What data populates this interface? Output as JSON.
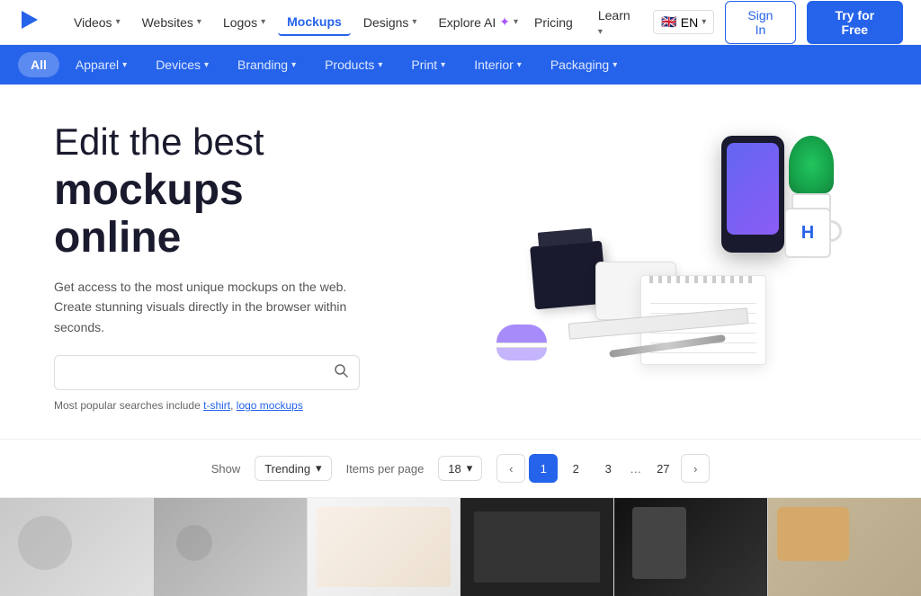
{
  "topnav": {
    "logo_label": "Placeit",
    "items": [
      {
        "label": "Videos",
        "has_chevron": true,
        "active": false
      },
      {
        "label": "Websites",
        "has_chevron": true,
        "active": false
      },
      {
        "label": "Logos",
        "has_chevron": true,
        "active": false
      },
      {
        "label": "Mockups",
        "has_chevron": false,
        "active": true
      },
      {
        "label": "Designs",
        "has_chevron": true,
        "active": false
      },
      {
        "label": "Explore AI",
        "has_chevron": true,
        "active": false,
        "ai": true
      }
    ],
    "right": {
      "pricing": "Pricing",
      "learn": "Learn",
      "lang": "EN",
      "sign_in": "Sign In",
      "try_free": "Try for Free"
    }
  },
  "catbar": {
    "items": [
      {
        "label": "All",
        "active": true,
        "has_chevron": false
      },
      {
        "label": "Apparel",
        "has_chevron": true,
        "active": false
      },
      {
        "label": "Devices",
        "has_chevron": true,
        "active": false
      },
      {
        "label": "Branding",
        "has_chevron": true,
        "active": false
      },
      {
        "label": "Products",
        "has_chevron": true,
        "active": false
      },
      {
        "label": "Print",
        "has_chevron": true,
        "active": false
      },
      {
        "label": "Interior",
        "has_chevron": true,
        "active": false
      },
      {
        "label": "Packaging",
        "has_chevron": true,
        "active": false
      }
    ]
  },
  "hero": {
    "title_light": "Edit the best",
    "title_bold_line1": "mockups",
    "title_bold_line2": "online",
    "subtitle": "Get access to the most unique mockups on the web. Create stunning visuals directly in the browser within seconds.",
    "search_placeholder": "",
    "popular_label": "Most popular searches include",
    "popular_links": [
      "t-shirt",
      "logo mockups"
    ]
  },
  "showbar": {
    "show_label": "Show",
    "trending_label": "Trending",
    "items_label": "Items per page",
    "items_count": "18",
    "pages": [
      "1",
      "2",
      "3",
      "...",
      "27"
    ],
    "current_page": "1"
  }
}
